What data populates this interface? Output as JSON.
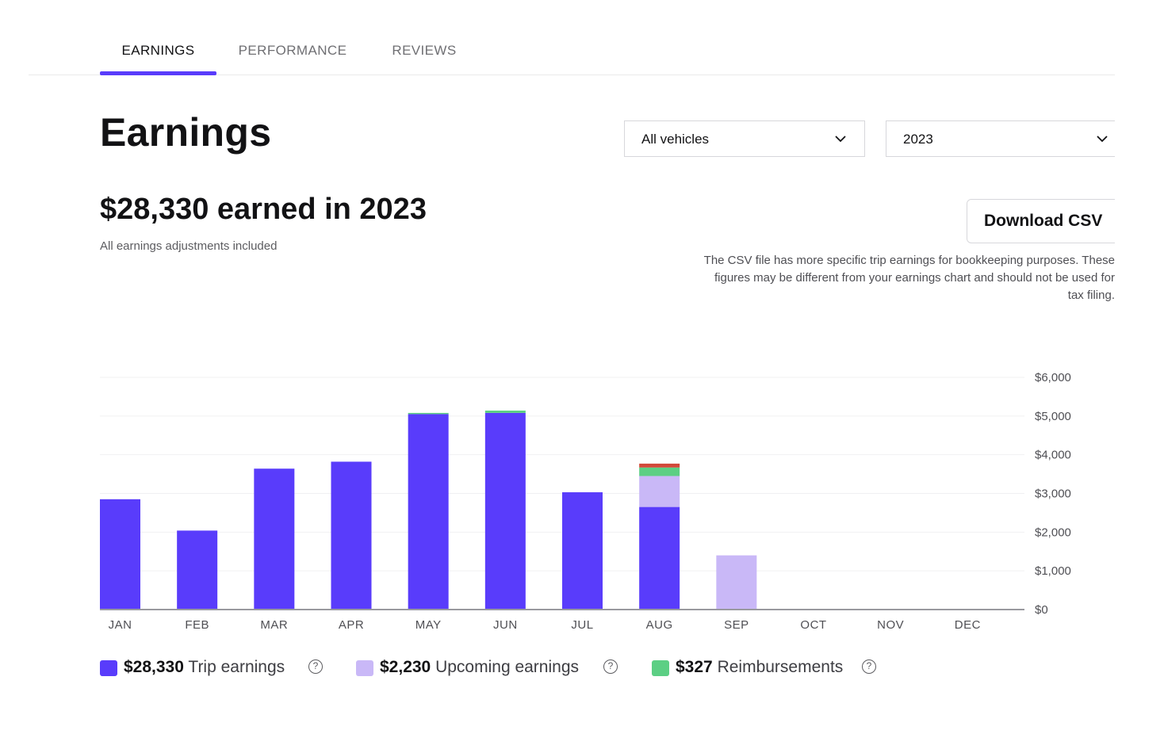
{
  "tabs": [
    {
      "label": "EARNINGS",
      "active": true
    },
    {
      "label": "PERFORMANCE",
      "active": false
    },
    {
      "label": "REVIEWS",
      "active": false
    }
  ],
  "page_title": "Earnings",
  "filters": {
    "vehicle": {
      "value": "All vehicles",
      "icon": "chevron-down-icon"
    },
    "year": {
      "value": "2023",
      "icon": "chevron-down-icon"
    }
  },
  "summary": {
    "headline": "$28,330 earned in 2023",
    "subtext": "All earnings adjustments included"
  },
  "download": {
    "label": "Download CSV",
    "note": "The CSV file has more specific trip earnings for bookkeeping purposes. These figures may be different from your earnings chart and should not be used for tax filing."
  },
  "colors": {
    "trip": "#593cfb",
    "upcoming": "#c9b8f7",
    "reimbursement": "#5ccf84",
    "adjustment": "#d2493a",
    "axis": "#9a9a9f",
    "grid": "#f0f0f2"
  },
  "chart_data": {
    "type": "bar",
    "stacked": true,
    "categories": [
      "JAN",
      "FEB",
      "MAR",
      "APR",
      "MAY",
      "JUN",
      "JUL",
      "AUG",
      "SEP",
      "OCT",
      "NOV",
      "DEC"
    ],
    "series": [
      {
        "name": "Trip earnings",
        "color": "#593cfb",
        "values": [
          2850,
          2040,
          3640,
          3820,
          5050,
          5080,
          3030,
          2650,
          0,
          0,
          0,
          0
        ]
      },
      {
        "name": "Upcoming earnings",
        "color": "#c9b8f7",
        "values": [
          0,
          0,
          0,
          0,
          0,
          0,
          0,
          800,
          1400,
          0,
          0,
          0
        ]
      },
      {
        "name": "Reimbursements",
        "color": "#5ccf84",
        "values": [
          0,
          0,
          0,
          0,
          30,
          60,
          0,
          220,
          0,
          0,
          0,
          0
        ]
      },
      {
        "values": [
          0,
          0,
          0,
          0,
          0,
          0,
          0,
          100,
          0,
          0,
          0,
          0
        ],
        "color": "#d2493a"
      }
    ],
    "y_ticks": [
      "$0",
      "$1,000",
      "$2,000",
      "$3,000",
      "$4,000",
      "$5,000",
      "$6,000"
    ],
    "ylim": [
      0,
      6000
    ],
    "yaxis_side": "right",
    "grid": true
  },
  "legend": [
    {
      "amount": "$28,330",
      "label": "Trip earnings",
      "swatch": "#593cfb",
      "icon": "help-circle-icon"
    },
    {
      "amount": "$2,230",
      "label": "Upcoming earnings",
      "swatch": "#c9b8f7",
      "icon": "help-circle-icon"
    },
    {
      "amount": "$327",
      "label": "Reimbursements",
      "swatch": "#5ccf84",
      "icon": "help-circle-icon"
    }
  ]
}
